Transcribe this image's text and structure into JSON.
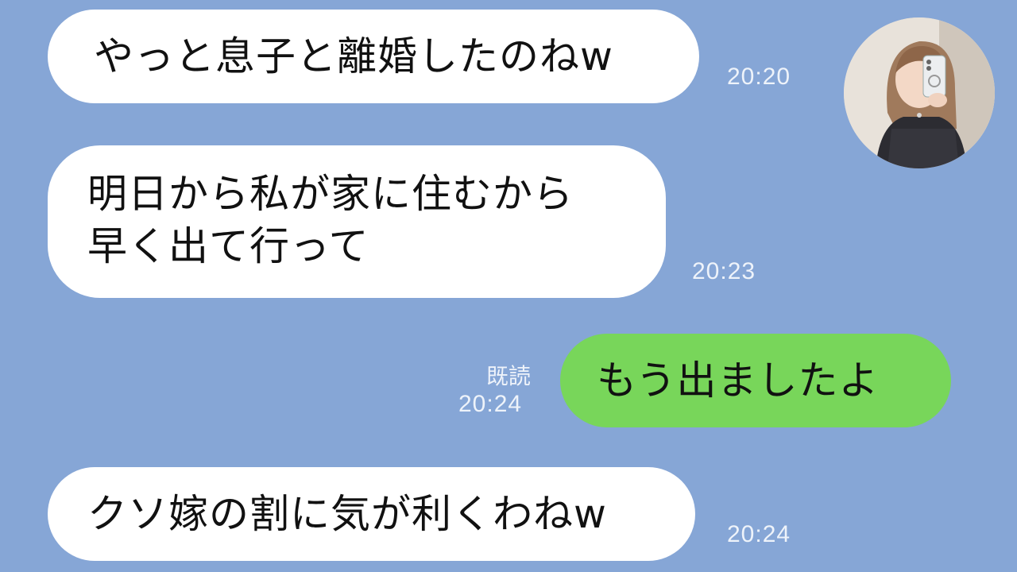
{
  "messages": [
    {
      "side": "received",
      "lines": [
        "やっと息子と離婚したのねw"
      ],
      "time": "20:20"
    },
    {
      "side": "received",
      "lines": [
        "明日から私が家に住むから",
        "早く出て行って"
      ],
      "time": "20:23"
    },
    {
      "side": "sent",
      "lines": [
        "もう出ましたよ"
      ],
      "time": "20:24",
      "read": "既読"
    },
    {
      "side": "received",
      "lines": [
        "クソ嫁の割に気が利くわねw"
      ],
      "time": "20:24"
    }
  ],
  "contact": {
    "avatar": "contact-avatar-photo"
  },
  "colors": {
    "background": "#86a6d6",
    "received_bubble": "#ffffff",
    "sent_bubble": "#78d65a",
    "meta_text": "#eef3fa"
  }
}
